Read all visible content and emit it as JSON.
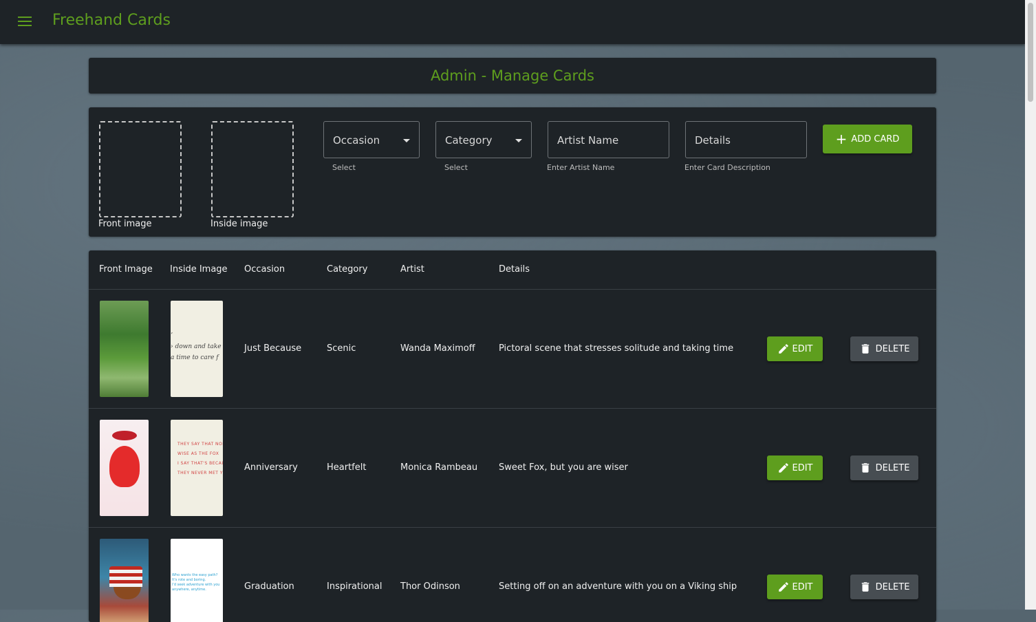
{
  "app": {
    "title": "Freehand Cards"
  },
  "page": {
    "title": "Admin - Manage Cards"
  },
  "form": {
    "front_image_label": "Front image",
    "inside_image_label": "Inside image",
    "occasion": {
      "label": "Occasion",
      "hint": "Select"
    },
    "category": {
      "label": "Category",
      "hint": "Select"
    },
    "artist": {
      "label": "Artist Name",
      "hint": "Enter Artist Name"
    },
    "details": {
      "label": "Details",
      "hint": "Enter Card Description"
    },
    "add_button": "ADD CARD"
  },
  "table": {
    "headers": [
      "Front Image",
      "Inside Image",
      "Occasion",
      "Category",
      "Artist",
      "Details"
    ],
    "rows": [
      {
        "occasion": "Just Because",
        "category": "Scenic",
        "artist": "Wanda Maximoff",
        "details": "Pictoral scene that stresses solitude and taking time",
        "edit": "EDIT",
        "delete": "DELETE"
      },
      {
        "occasion": "Anniversary",
        "category": "Heartfelt",
        "artist": "Monica Rambeau",
        "details": "Sweet Fox, but you are wiser",
        "edit": "EDIT",
        "delete": "DELETE"
      },
      {
        "occasion": "Graduation",
        "category": "Inspirational",
        "artist": "Thor Odinson",
        "details": "Setting off on an adventure with you on a Viking ship",
        "edit": "EDIT",
        "delete": "DELETE"
      }
    ]
  },
  "colors": {
    "accent": "#5e9e1e",
    "panel": "#1e2327",
    "delete": "#474d52"
  }
}
